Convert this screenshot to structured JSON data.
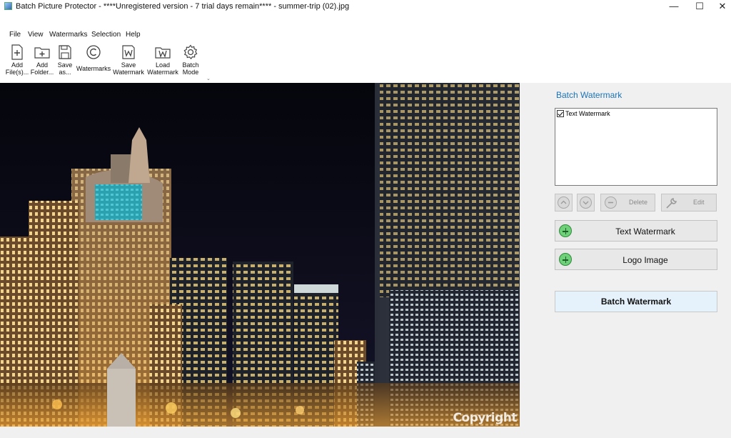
{
  "window": {
    "title": "Batch Picture Protector - ****Unregistered version - 7 trial days remain**** - summer-trip (02).jpg",
    "minimize": "—",
    "maximize": "☐",
    "close": "✕"
  },
  "menu": [
    {
      "label": "File"
    },
    {
      "label": "View"
    },
    {
      "label": "Watermarks"
    },
    {
      "label": "Selection"
    },
    {
      "label": "Help"
    }
  ],
  "toolbar": {
    "add_files": "Add\nFile(s)...",
    "add_folder": "Add\nFolder...",
    "save_as": "Save\nas...",
    "watermarks": "Watermarks",
    "save_watermark": "Save\nWatermark",
    "load_watermark": "Load\nWatermark",
    "batch_mode": "Batch\nMode"
  },
  "image": {
    "watermark_text": "Copyright"
  },
  "panel": {
    "title": "Batch Watermark",
    "list_items": [
      {
        "label": "Text Watermark",
        "checked": true
      }
    ],
    "delete_label": "Delete",
    "edit_label": "Edit",
    "text_watermark_label": "Text Watermark",
    "logo_image_label": "Logo Image",
    "batch_watermark_label": "Batch Watermark"
  },
  "colors": {
    "accent": "#1b74b8",
    "batch_button_bg": "#e5f1fb",
    "add_icon_green": "#6fd07a"
  }
}
